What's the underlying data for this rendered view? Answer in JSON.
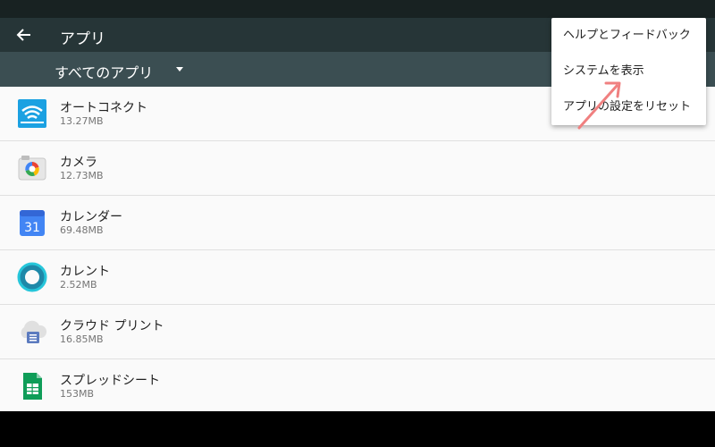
{
  "app_bar": {
    "title": "アプリ"
  },
  "filter": {
    "label": "すべてのアプリ"
  },
  "apps": [
    {
      "name": "オートコネクト",
      "size": "13.27MB",
      "icon": "auto-connect-icon"
    },
    {
      "name": "カメラ",
      "size": "12.73MB",
      "icon": "camera-icon"
    },
    {
      "name": "カレンダー",
      "size": "69.48MB",
      "icon": "calendar-icon",
      "icon_text": "31"
    },
    {
      "name": "カレント",
      "size": "2.52MB",
      "icon": "current-icon"
    },
    {
      "name": "クラウド プリント",
      "size": "16.85MB",
      "icon": "cloud-print-icon"
    },
    {
      "name": "スプレッドシート",
      "size": "153MB",
      "icon": "spreadsheet-icon"
    }
  ],
  "menu": {
    "items": [
      "ヘルプとフィードバック",
      "システムを表示",
      "アプリの設定をリセット"
    ]
  },
  "colors": {
    "app_bar": "#263537",
    "filter_bar": "#3b4e52",
    "annotation_arrow": "#f08080"
  }
}
